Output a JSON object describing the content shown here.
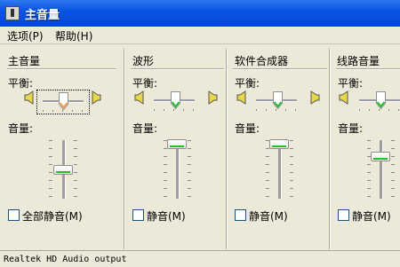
{
  "window": {
    "title": "主音量",
    "icon": "speaker-app-icon"
  },
  "menu": [
    {
      "label": "选项(P)"
    },
    {
      "label": "帮助(H)"
    }
  ],
  "panels": [
    {
      "title": "主音量",
      "balance_label": "平衡:",
      "volume_label": "音量:",
      "mute_label": "全部静音(M)",
      "balance_level": 0.5,
      "volume_level": 0.45,
      "muted": false
    },
    {
      "title": "波形",
      "balance_label": "平衡:",
      "volume_label": "音量:",
      "mute_label": "静音(M)",
      "balance_level": 0.5,
      "volume_level": 1.0,
      "muted": false
    },
    {
      "title": "软件合成器",
      "balance_label": "平衡:",
      "volume_label": "音量:",
      "mute_label": "静音(M)",
      "balance_level": 0.5,
      "volume_level": 1.0,
      "muted": false
    },
    {
      "title": "线路音量",
      "balance_label": "平衡:",
      "volume_label": "音量:",
      "mute_label": "静音(M)",
      "balance_level": 0.5,
      "volume_level": 0.75,
      "muted": false
    }
  ],
  "status": {
    "text": "Realtek HD Audio output"
  },
  "colors": {
    "title_bar": "#0a54e2",
    "thumb_accent": "#21c02a",
    "balance_thumb_master": "#f5a34b",
    "window_bg": "#ece9d8"
  }
}
